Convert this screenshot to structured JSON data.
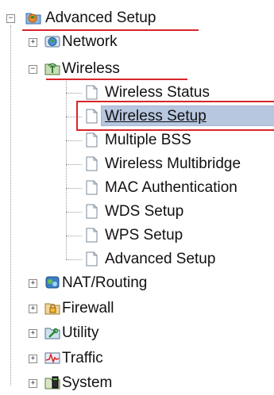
{
  "tree": {
    "root": {
      "label": "Advanced Setup",
      "icon": "folder-globe-icon",
      "expanded": true
    },
    "network": {
      "label": "Network",
      "icon": "network-globe-icon"
    },
    "wireless": {
      "label": "Wireless",
      "icon": "wireless-antenna-icon",
      "expanded": true,
      "children": [
        {
          "label": "Wireless Status",
          "icon": "page-icon"
        },
        {
          "label": "Wireless Setup",
          "icon": "page-icon",
          "selected": true
        },
        {
          "label": "Multiple BSS",
          "icon": "page-icon"
        },
        {
          "label": "Wireless Multibridge",
          "icon": "page-icon"
        },
        {
          "label": "MAC Authentication",
          "icon": "page-icon"
        },
        {
          "label": "WDS Setup",
          "icon": "page-icon"
        },
        {
          "label": "WPS Setup",
          "icon": "page-icon"
        },
        {
          "label": "Advanced Setup",
          "icon": "page-icon"
        }
      ]
    },
    "nat_routing": {
      "label": "NAT/Routing",
      "icon": "nat-routing-icon"
    },
    "firewall": {
      "label": "Firewall",
      "icon": "firewall-lock-icon"
    },
    "utility": {
      "label": "Utility",
      "icon": "utility-tools-icon"
    },
    "traffic": {
      "label": "Traffic",
      "icon": "traffic-graph-icon"
    },
    "system": {
      "label": "System",
      "icon": "system-computer-icon"
    }
  },
  "colors": {
    "selection": "#b8c7e0",
    "annotation_red": "#d9252c"
  }
}
